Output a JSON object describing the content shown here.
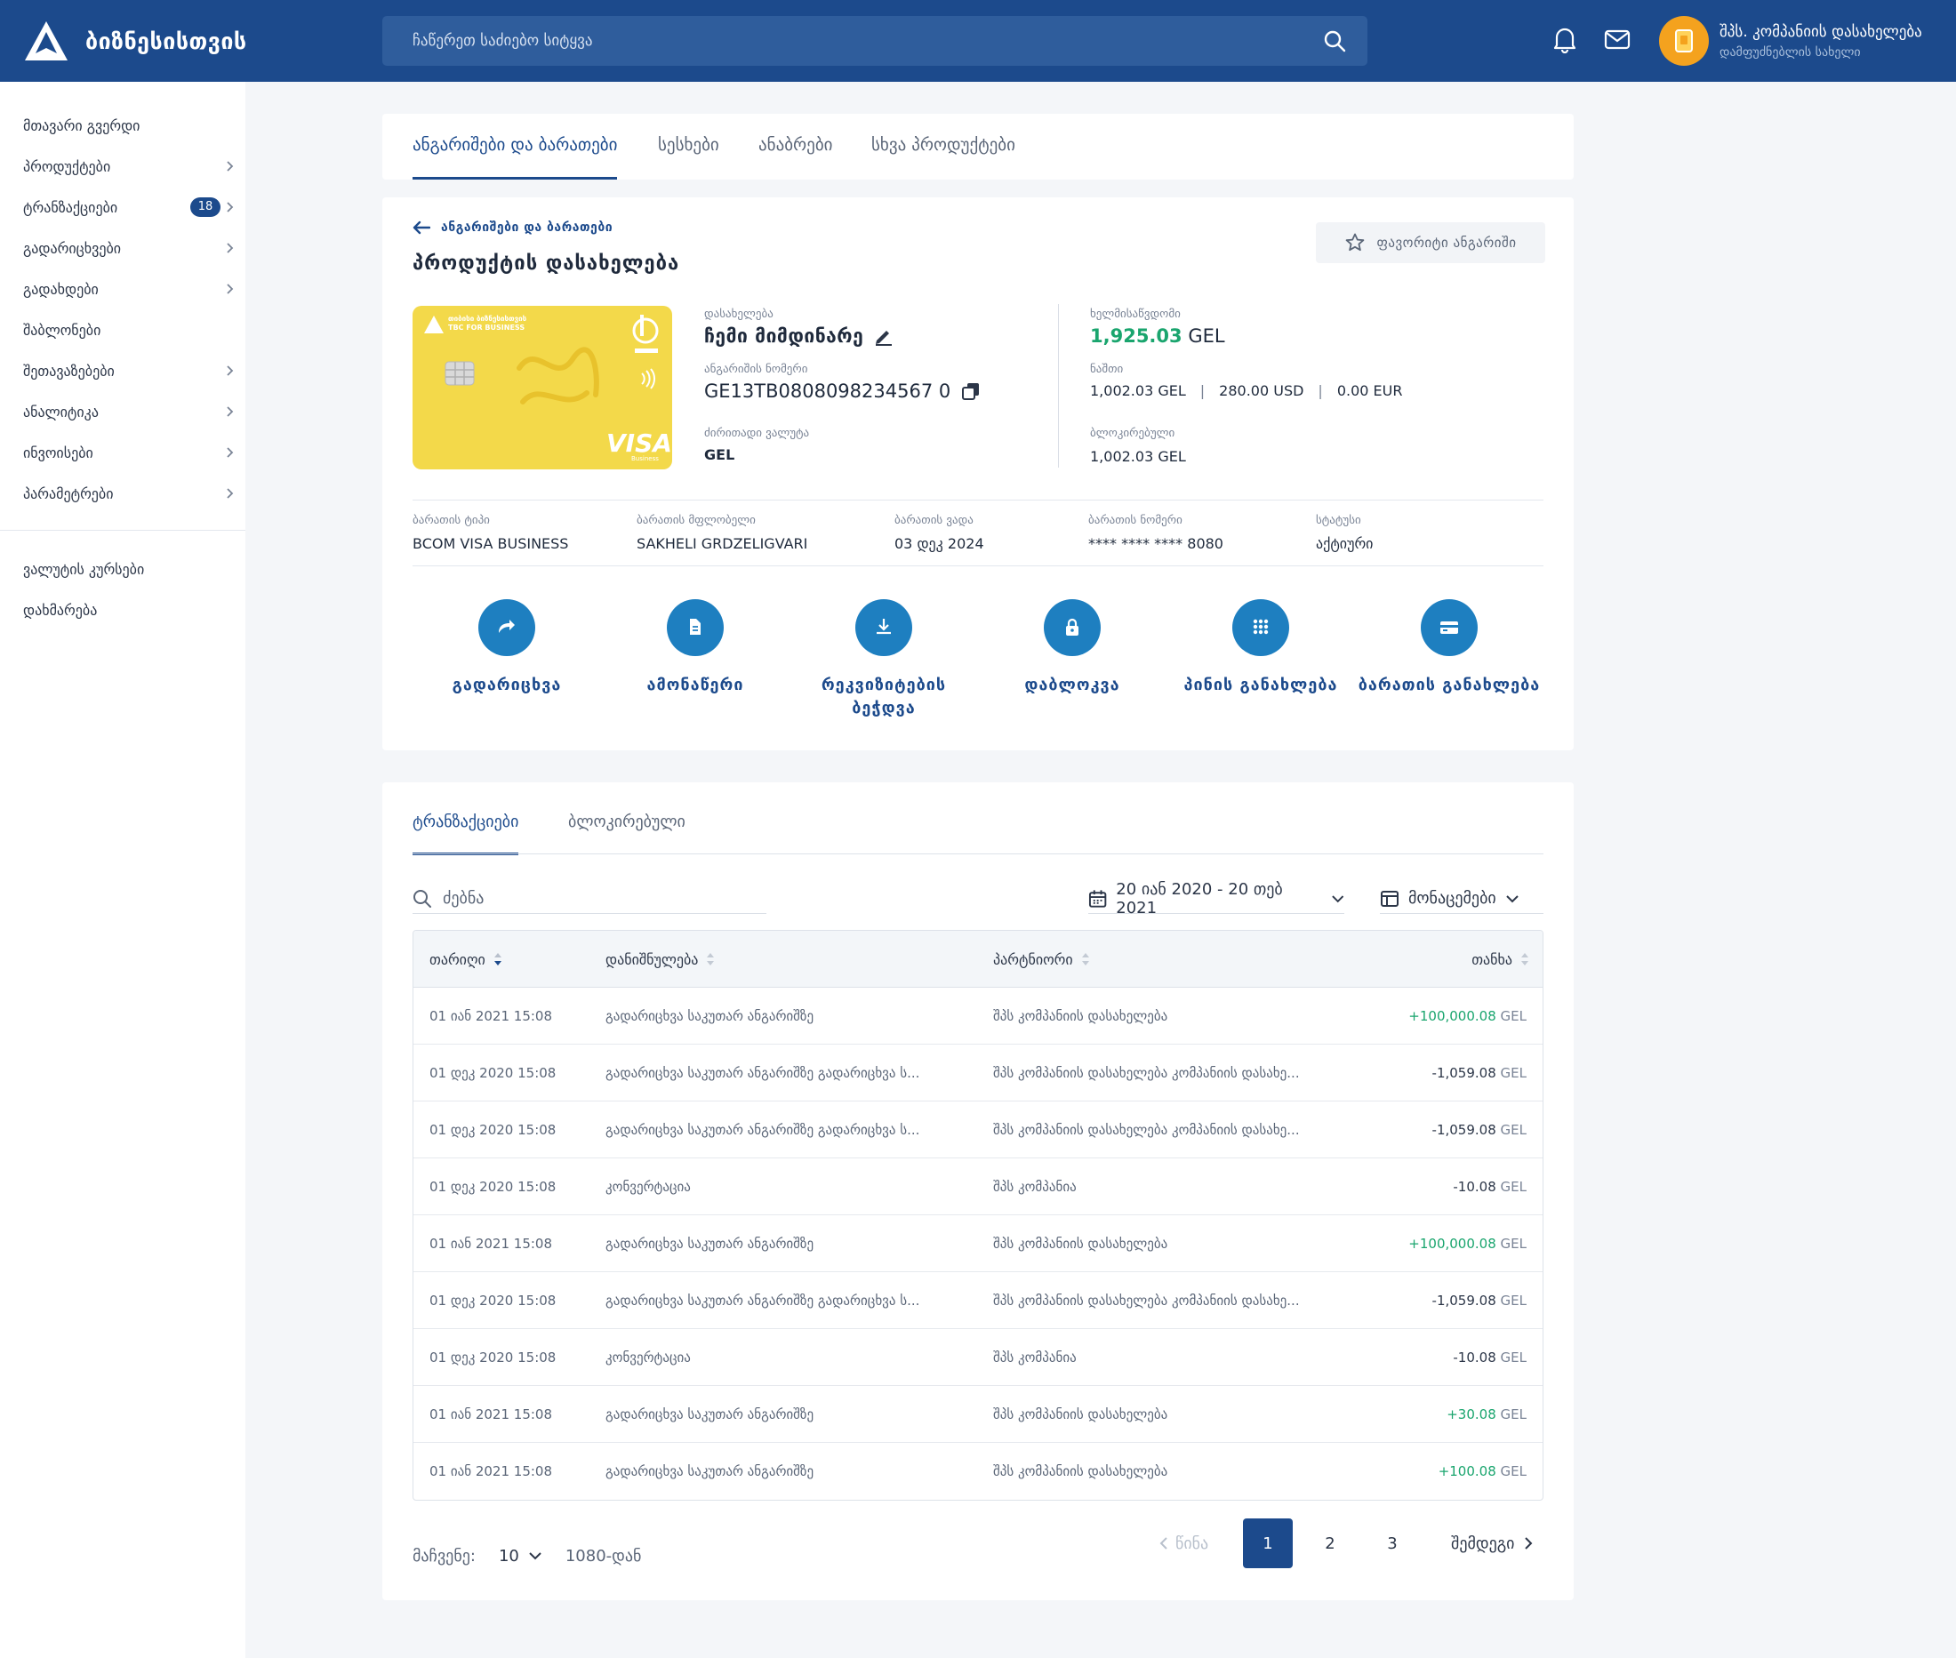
{
  "brand": {
    "name": "ბიზნესისთვის"
  },
  "search": {
    "placeholder": "ჩაწერეთ საძიებო სიტყვა"
  },
  "user": {
    "name": "შპს. კომპანიის დასახელება",
    "subtitle": "დამფუძნებლის სახელი"
  },
  "sidebar": {
    "items": [
      {
        "label": "მთავარი გვერდი",
        "chevron": false
      },
      {
        "label": "პროდუქტები",
        "chevron": true
      },
      {
        "label": "ტრანზაქციები",
        "chevron": true,
        "badge": "18"
      },
      {
        "label": "გადარიცხვები",
        "chevron": true
      },
      {
        "label": "გადახდები",
        "chevron": true
      },
      {
        "label": "შაბლონები",
        "chevron": false
      },
      {
        "label": "შეთავაზებები",
        "chevron": true
      },
      {
        "label": "ანალიტიკა",
        "chevron": true
      },
      {
        "label": "ინვოისები",
        "chevron": true
      },
      {
        "label": "პარამეტრები",
        "chevron": true
      }
    ],
    "bottom_items": [
      {
        "label": "ვალუტის კურსები"
      },
      {
        "label": "დახმარება"
      }
    ]
  },
  "tabs": [
    {
      "label": "ანგარიშები და ბარათები",
      "active": true
    },
    {
      "label": "სესხები",
      "active": false
    },
    {
      "label": "ანაბრები",
      "active": false
    },
    {
      "label": "სხვა პროდუქტები",
      "active": false
    }
  ],
  "detail": {
    "back_label": "ანგარიშები და ბარათები",
    "product_title": "პროდუქტის დასახელება",
    "favorite_label": "ფავორიტი ანგარიში",
    "card": {
      "bank_name": "თიბისი ბიზნესისთვის",
      "bank_name_en": "TBC FOR BUSINESS",
      "brand": "VISA",
      "brand_sub": "Business"
    },
    "name_label": "დასახელება",
    "name_value": "ჩემი მიმდინარე",
    "account_label": "ანგარიშის ნომერი",
    "account_value": "GE13TB0808098234567 0",
    "currency_label": "ძირითადი ვალუტა",
    "currency_value": "GEL",
    "available_label": "ხელმისაწვდომი",
    "available_amount": "1,925.03",
    "available_currency": "GEL",
    "balance_label": "ნაშთი",
    "balances": [
      "1,002.03 GEL",
      "280.00 USD",
      "0.00 EUR"
    ],
    "blocked_label": "ბლოკირებული",
    "blocked_value": "1,002.03 GEL",
    "card_info": [
      {
        "label": "ბარათის ტიპი",
        "value": "BCOM VISA BUSINESS"
      },
      {
        "label": "ბარათის მფლობელი",
        "value": "SAKHELI GRDZELIGVARI"
      },
      {
        "label": "ბარათის ვადა",
        "value": "03 დეკ 2024"
      },
      {
        "label": "ბარათის ნომერი",
        "value": "**** **** **** 8080"
      },
      {
        "label": "სტატუსი",
        "value": "აქტიური"
      }
    ],
    "actions": [
      {
        "label": "გადარიცხვა",
        "icon": "share-arrow-icon"
      },
      {
        "label": "ამონაწერი",
        "icon": "document-icon"
      },
      {
        "label": "რეკვიზიტების ბეჭდვა",
        "icon": "download-icon"
      },
      {
        "label": "დაბლოკვა",
        "icon": "lock-icon"
      },
      {
        "label": "პინის განახლება",
        "icon": "keypad-icon"
      },
      {
        "label": "ბარათის განახლება",
        "icon": "card-icon"
      }
    ]
  },
  "transactions": {
    "tabs": [
      {
        "label": "ტრანზაქციები",
        "active": true
      },
      {
        "label": "ბლოკირებული",
        "active": false
      }
    ],
    "search_placeholder": "ძებნა",
    "date_range": "20 იან 2020 - 20 თებ 2021",
    "columns_label": "მონაცემები",
    "headers": {
      "date": "თარიღი",
      "purpose": "დანიშნულება",
      "partner": "პარტნიორი",
      "amount": "თანხა"
    },
    "rows": [
      {
        "date": "01 იან 2021 15:08",
        "purpose": "გადარიცხვა საკუთარ ანგარიშზე",
        "partner": "შპს კომპანიის დასახელება",
        "amount": "+100,000.08",
        "currency": "GEL",
        "positive": true
      },
      {
        "date": "01 დეკ 2020 15:08",
        "purpose": "გადარიცხვა საკუთარ ანგარიშზე გადარიცხვა ს...",
        "partner": "შპს კომპანიის დასახელება კომპანიის დასახე...",
        "amount": "-1,059.08",
        "currency": "GEL",
        "positive": false
      },
      {
        "date": "01 დეკ 2020 15:08",
        "purpose": "გადარიცხვა საკუთარ ანგარიშზე გადარიცხვა ს...",
        "partner": "შპს კომპანიის დასახელება კომპანიის დასახე...",
        "amount": "-1,059.08",
        "currency": "GEL",
        "positive": false
      },
      {
        "date": "01 დეკ 2020 15:08",
        "purpose": "კონვერტაცია",
        "partner": "შპს კომპანია",
        "amount": "-10.08",
        "currency": "GEL",
        "positive": false
      },
      {
        "date": "01 იან 2021 15:08",
        "purpose": "გადარიცხვა საკუთარ ანგარიშზე",
        "partner": "შპს კომპანიის დასახელება",
        "amount": "+100,000.08",
        "currency": "GEL",
        "positive": true
      },
      {
        "date": "01 დეკ 2020 15:08",
        "purpose": "გადარიცხვა საკუთარ ანგარიშზე გადარიცხვა ს...",
        "partner": "შპს კომპანიის დასახელება კომპანიის დასახე...",
        "amount": "-1,059.08",
        "currency": "GEL",
        "positive": false
      },
      {
        "date": "01 დეკ 2020 15:08",
        "purpose": "კონვერტაცია",
        "partner": "შპს კომპანია",
        "amount": "-10.08",
        "currency": "GEL",
        "positive": false
      },
      {
        "date": "01 იან 2021 15:08",
        "purpose": "გადარიცხვა საკუთარ ანგარიშზე",
        "partner": "შპს კომპანიის დასახელება",
        "amount": "+30.08",
        "currency": "GEL",
        "positive": true
      },
      {
        "date": "01 იან 2021 15:08",
        "purpose": "გადარიცხვა საკუთარ ანგარიშზე",
        "partner": "შპს კომპანიის დასახელება",
        "amount": "+100.08",
        "currency": "GEL",
        "positive": true
      }
    ],
    "pagination": {
      "show_label": "მაჩვენე:",
      "page_size": "10",
      "range_text": "1080-დან",
      "prev_label": "წინა",
      "pages": [
        "1",
        "2",
        "3"
      ],
      "current_page": "1",
      "next_label": "შემდეგი"
    }
  },
  "colors": {
    "primary": "#1c4a8c",
    "accent": "#1e7fc0",
    "positive": "#1aa56e",
    "card_yellow": "#f3d94a",
    "avatar_orange": "#f4a21e"
  }
}
